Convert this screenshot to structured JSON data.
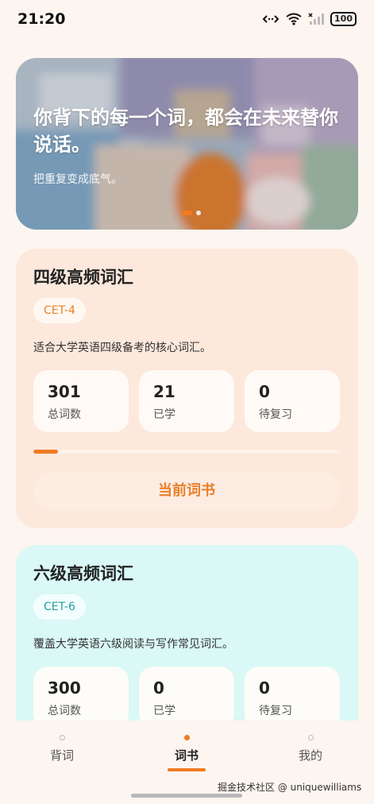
{
  "status": {
    "time": "21:20",
    "battery": "100"
  },
  "banner": {
    "title": "你背下的每一个词，都会在未来替你说话。",
    "subtitle": "把重复变成底气。",
    "page_count": 2,
    "active_page": 1
  },
  "books": [
    {
      "title": "四级高频词汇",
      "tag": "CET-4",
      "desc": "适合大学英语四级备考的核心词汇。",
      "stats": [
        {
          "value": "301",
          "label": "总词数"
        },
        {
          "value": "21",
          "label": "已学"
        },
        {
          "value": "0",
          "label": "待复习"
        }
      ],
      "progress_fraction": 0.08,
      "action_label": "当前词书"
    },
    {
      "title": "六级高频词汇",
      "tag": "CET-6",
      "desc": "覆盖大学英语六级阅读与写作常见词汇。",
      "stats": [
        {
          "value": "300",
          "label": "总词数"
        },
        {
          "value": "0",
          "label": "已学"
        },
        {
          "value": "0",
          "label": "待复习"
        }
      ]
    }
  ],
  "tabs": [
    {
      "label": "背词",
      "active": false
    },
    {
      "label": "词书",
      "active": true
    },
    {
      "label": "我的",
      "active": false
    }
  ],
  "watermark": "掘金技术社区 @ uniquewilliams",
  "colors": {
    "accent": "#f07b22",
    "page_bg": "#fdf5ef",
    "cet4_card_bg": "#fde8dc",
    "cet6_card_bg": "#d9f8f6"
  }
}
